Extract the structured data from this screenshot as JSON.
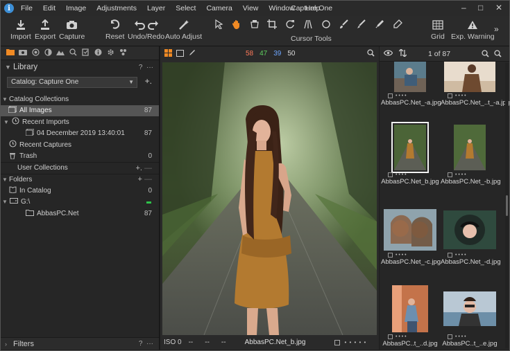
{
  "app": {
    "title": "Capture One",
    "logo_letter": "i"
  },
  "menu": [
    "File",
    "Edit",
    "Image",
    "Adjustments",
    "Layer",
    "Select",
    "Camera",
    "View",
    "Window",
    "Help"
  ],
  "window_controls": {
    "minimize": "–",
    "maximize": "□",
    "close": "✕"
  },
  "toolbar": {
    "import": "Import",
    "export": "Export",
    "capture": "Capture",
    "reset": "Reset",
    "undo_redo": "Undo/Redo",
    "auto_adjust": "Auto Adjust",
    "cursor_tools": "Cursor Tools",
    "grid": "Grid",
    "exp_warning": "Exp. Warning",
    "more": "»"
  },
  "library": {
    "title": "Library",
    "help": "?",
    "menu": "···",
    "catalog_select": "Catalog: Capture One",
    "catalog_collections": "Catalog Collections",
    "all_images": {
      "label": "All Images",
      "count": "87"
    },
    "recent_imports": "Recent Imports",
    "import_entry": {
      "label": "04 December 2019 13:40:01",
      "count": "87"
    },
    "recent_captures": "Recent Captures",
    "trash": {
      "label": "Trash",
      "count": "0"
    },
    "user_collections": "User Collections",
    "folders": "Folders",
    "in_catalog": {
      "label": "In Catalog",
      "count": "0"
    },
    "drive": {
      "label": "G:\\"
    },
    "folder": {
      "label": "AbbasPC.Net",
      "count": "87"
    }
  },
  "filters": {
    "title": "Filters",
    "help": "?",
    "menu": "···"
  },
  "viewer": {
    "hist_r": "58",
    "hist_g": "47",
    "hist_b": "39",
    "hist_l": "50",
    "iso": "ISO 0",
    "dash1": "--",
    "dash2": "--",
    "dash3": "--",
    "filename": "AbbasPC.Net_b.jpg",
    "rating": "• • • • •"
  },
  "browser": {
    "count": "1 of 87",
    "thumbs": [
      {
        "name": "AbbasPC.Net_-a.jpg"
      },
      {
        "name": "AbbasPC.Net_..t_-a.jpg"
      },
      {
        "name": "AbbasPC.Net_b.jpg"
      },
      {
        "name": "AbbasPC.Net_-b.jpg"
      },
      {
        "name": "AbbasPC.Net_-c.jpg"
      },
      {
        "name": "AbbasPC.Net_-d.jpg"
      },
      {
        "name": "AbbasPC..t_..d.jpg"
      },
      {
        "name": "AbbasPC..t_..e.jpg"
      }
    ],
    "rating": "• • • •"
  },
  "colors": {
    "accent": "#f08a24",
    "selection": "#555555",
    "green_status": "#2ec24a"
  }
}
